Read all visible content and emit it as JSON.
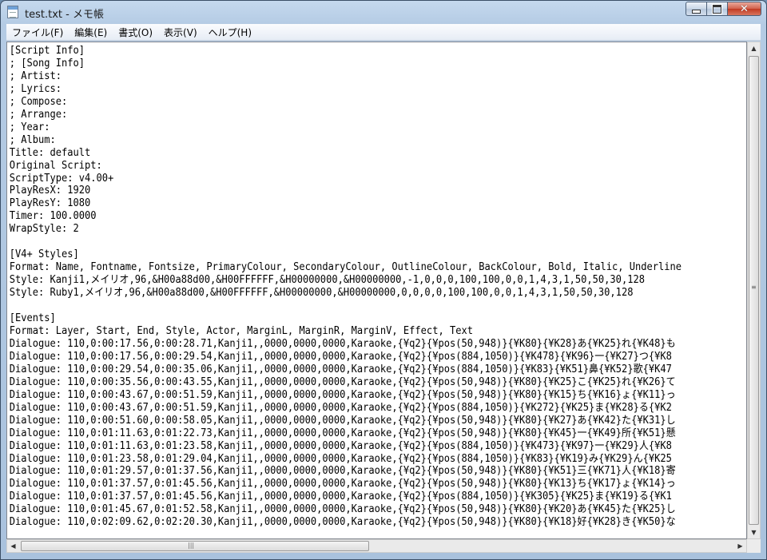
{
  "window": {
    "title": "test.txt - メモ帳",
    "minimize_glyph": "",
    "maximize_glyph": "",
    "close_glyph": "✕"
  },
  "menu": {
    "items": [
      "ファイル(F)",
      "編集(E)",
      "書式(O)",
      "表示(V)",
      "ヘルプ(H)"
    ]
  },
  "document": {
    "content": "[Script Info]\n; [Song Info]\n; Artist:\n; Lyrics:\n; Compose:\n; Arrange:\n; Year:\n; Album:\nTitle: default\nOriginal Script:\nScriptType: v4.00+\nPlayResX: 1920\nPlayResY: 1080\nTimer: 100.0000\nWrapStyle: 2\n\n[V4+ Styles]\nFormat: Name, Fontname, Fontsize, PrimaryColour, SecondaryColour, OutlineColour, BackColour, Bold, Italic, Underline\nStyle: Kanji1,メイリオ,96,&H00a88d00,&H00FFFFFF,&H00000000,&H00000000,-1,0,0,0,100,100,0,0,1,4,3,1,50,50,30,128\nStyle: Ruby1,メイリオ,96,&H00a88d00,&H00FFFFFF,&H00000000,&H00000000,0,0,0,0,100,100,0,0,1,4,3,1,50,50,30,128\n\n[Events]\nFormat: Layer, Start, End, Style, Actor, MarginL, MarginR, MarginV, Effect, Text\nDialogue: 110,0:00:17.56,0:00:28.71,Kanji1,,0000,0000,0000,Karaoke,{¥q2}{¥pos(50,948)}{¥K80}{¥K28}あ{¥K25}れ{¥K48}も\nDialogue: 110,0:00:17.56,0:00:29.54,Kanji1,,0000,0000,0000,Karaoke,{¥q2}{¥pos(884,1050)}{¥K478}{¥K96}一{¥K27}つ{¥K8\nDialogue: 110,0:00:29.54,0:00:35.06,Kanji1,,0000,0000,0000,Karaoke,{¥q2}{¥pos(884,1050)}{¥K83}{¥K51}鼻{¥K52}歌{¥K47\nDialogue: 110,0:00:35.56,0:00:43.55,Kanji1,,0000,0000,0000,Karaoke,{¥q2}{¥pos(50,948)}{¥K80}{¥K25}こ{¥K25}れ{¥K26}て\nDialogue: 110,0:00:43.67,0:00:51.59,Kanji1,,0000,0000,0000,Karaoke,{¥q2}{¥pos(50,948)}{¥K80}{¥K15}ち{¥K16}ょ{¥K11}っ\nDialogue: 110,0:00:43.67,0:00:51.59,Kanji1,,0000,0000,0000,Karaoke,{¥q2}{¥pos(884,1050)}{¥K272}{¥K25}ま{¥K28}る{¥K2\nDialogue: 110,0:00:51.60,0:00:58.05,Kanji1,,0000,0000,0000,Karaoke,{¥q2}{¥pos(50,948)}{¥K80}{¥K27}あ{¥K42}た{¥K31}し\nDialogue: 110,0:01:11.63,0:01:22.73,Kanji1,,0000,0000,0000,Karaoke,{¥q2}{¥pos(50,948)}{¥K80}{¥K45}一{¥K49}所{¥K51}懸\nDialogue: 110,0:01:11.63,0:01:23.58,Kanji1,,0000,0000,0000,Karaoke,{¥q2}{¥pos(884,1050)}{¥K473}{¥K97}一{¥K29}人{¥K8\nDialogue: 110,0:01:23.58,0:01:29.04,Kanji1,,0000,0000,0000,Karaoke,{¥q2}{¥pos(884,1050)}{¥K83}{¥K19}み{¥K29}ん{¥K25\nDialogue: 110,0:01:29.57,0:01:37.56,Kanji1,,0000,0000,0000,Karaoke,{¥q2}{¥pos(50,948)}{¥K80}{¥K51}三{¥K71}人{¥K18}寄\nDialogue: 110,0:01:37.57,0:01:45.56,Kanji1,,0000,0000,0000,Karaoke,{¥q2}{¥pos(50,948)}{¥K80}{¥K13}ち{¥K17}ょ{¥K14}っ\nDialogue: 110,0:01:37.57,0:01:45.56,Kanji1,,0000,0000,0000,Karaoke,{¥q2}{¥pos(884,1050)}{¥K305}{¥K25}ま{¥K19}る{¥K1\nDialogue: 110,0:01:45.67,0:01:52.58,Kanji1,,0000,0000,0000,Karaoke,{¥q2}{¥pos(50,948)}{¥K80}{¥K20}あ{¥K45}た{¥K25}し\nDialogue: 110,0:02:09.62,0:02:20.30,Kanji1,,0000,0000,0000,Karaoke,{¥q2}{¥pos(50,948)}{¥K80}{¥K18}好{¥K28}き{¥K50}な"
  },
  "scrollbars": {
    "up_arrow": "▲",
    "down_arrow": "▼",
    "left_arrow": "◀",
    "right_arrow": "▶",
    "grip": "≡",
    "hgrip": "|||"
  }
}
